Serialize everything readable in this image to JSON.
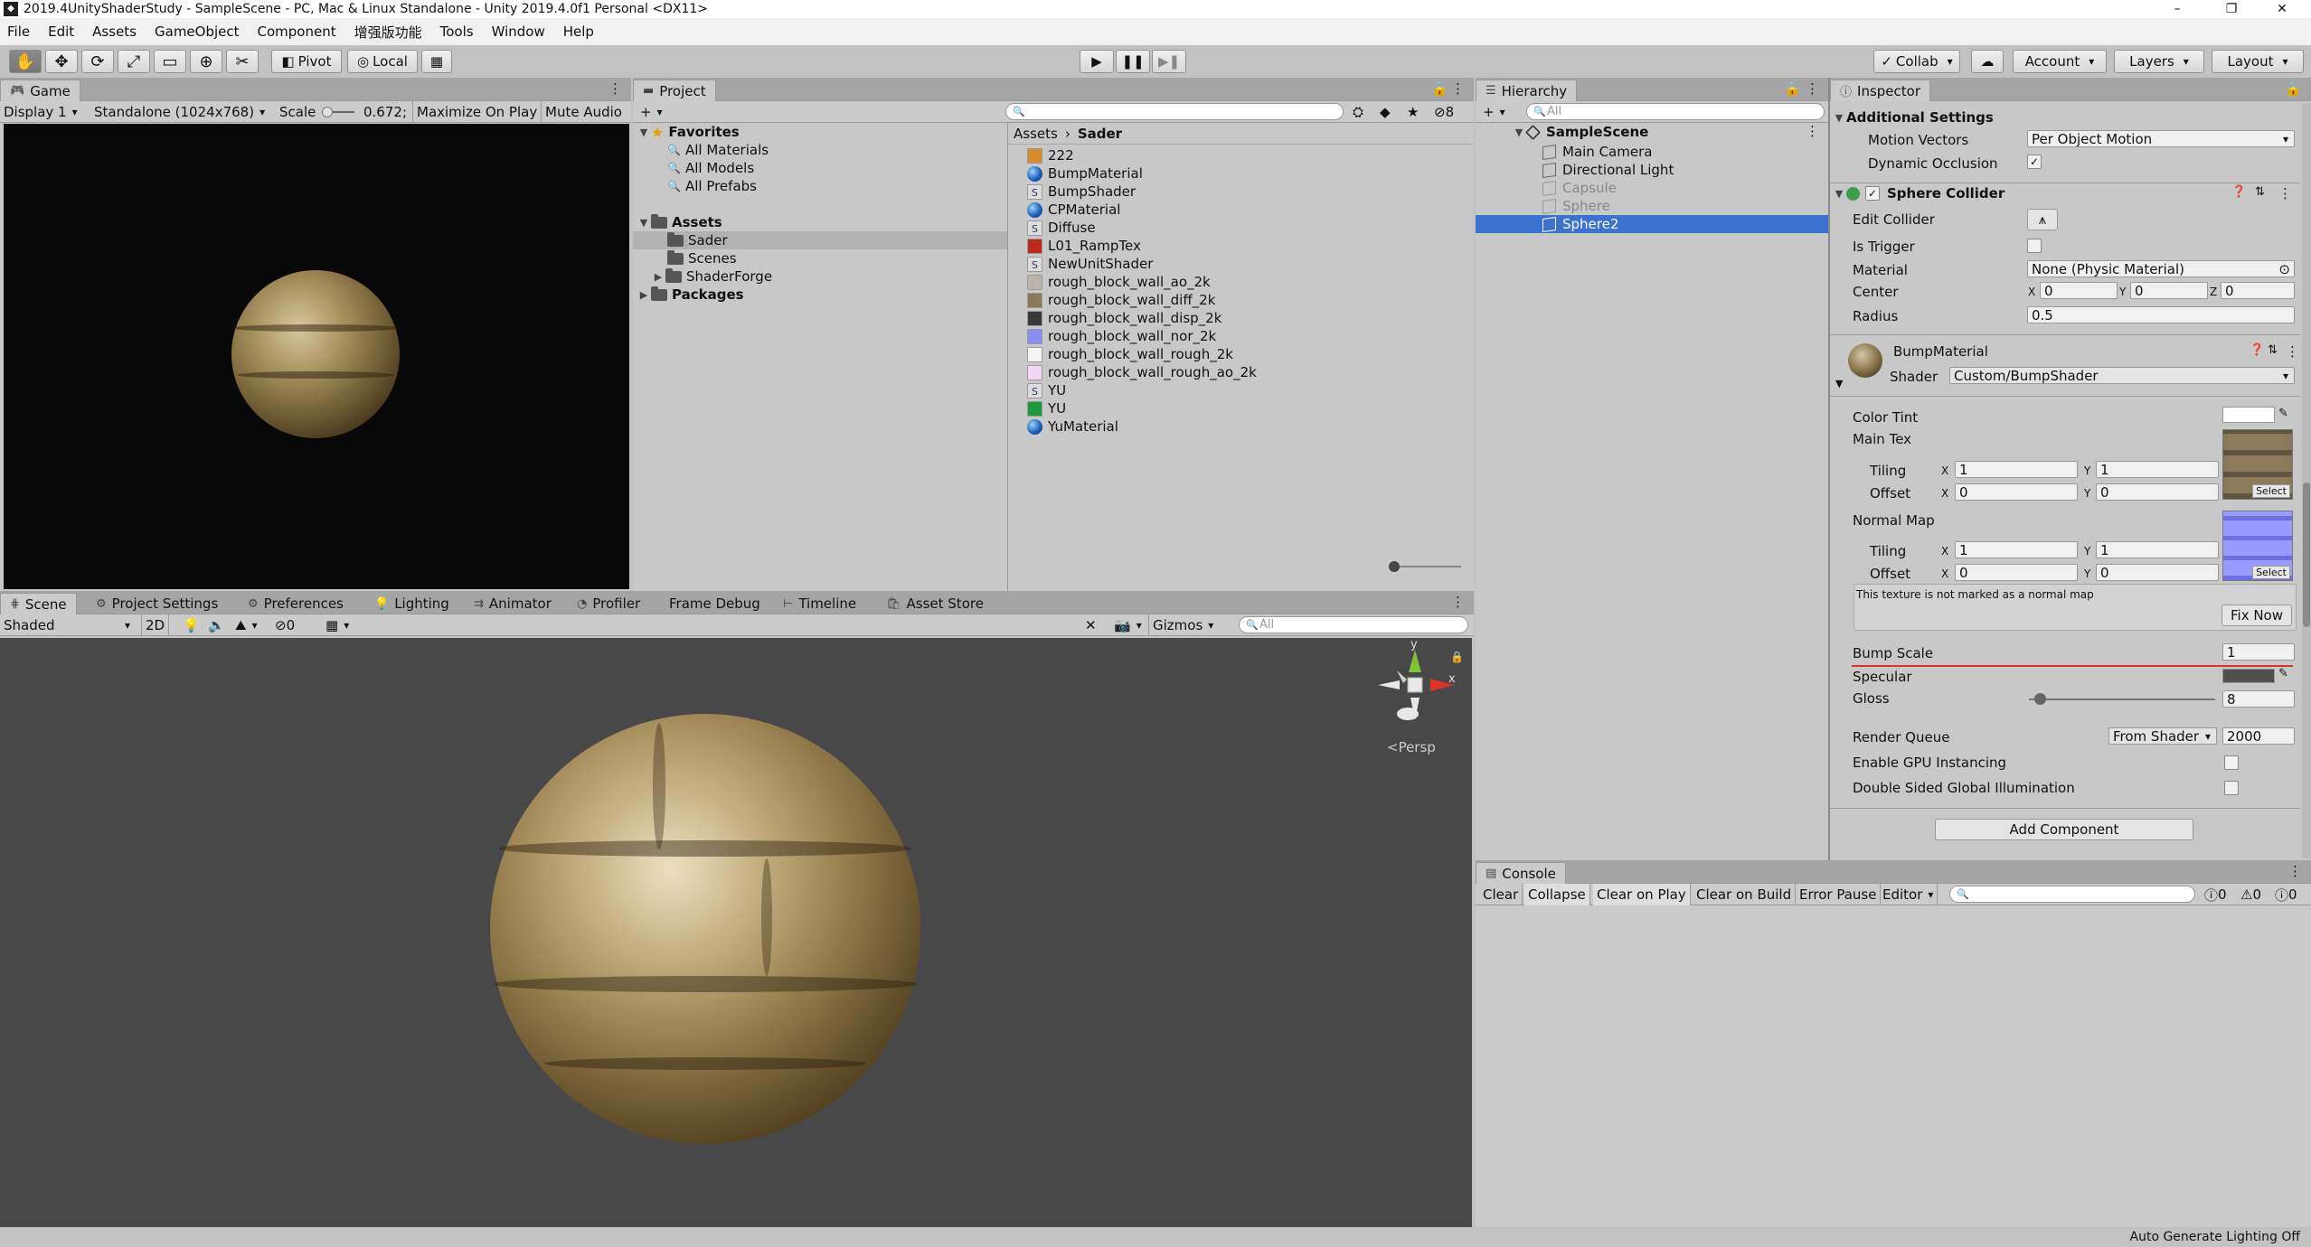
{
  "window": {
    "title": "2019.4UnityShaderStudy - SampleScene - PC, Mac & Linux Standalone - Unity 2019.4.0f1 Personal <DX11>",
    "app_icon_label": "◆",
    "minimize": "–",
    "maximize": "❐",
    "close": "✕"
  },
  "menu": [
    "File",
    "Edit",
    "Assets",
    "GameObject",
    "Component",
    "增强版功能",
    "Tools",
    "Window",
    "Help"
  ],
  "toolbar": {
    "tools": [
      "✋",
      "✥",
      "⟳",
      "⤢",
      "▭",
      "⊕",
      "✂"
    ],
    "pivot": "Pivot",
    "local": "Local",
    "collab": "Collab",
    "account": "Account",
    "layers": "Layers",
    "layout": "Layout",
    "play_icons": [
      "▶",
      "❚❚",
      "▶❚"
    ]
  },
  "game": {
    "tab": "Game",
    "display": "Display 1",
    "resolution": "Standalone (1024x768)",
    "scale_label": "Scale",
    "scale_value": "0.672;",
    "maximize": "Maximize On Play",
    "mute": "Mute Audio"
  },
  "project": {
    "tab": "Project",
    "add": "+",
    "hidden_count": "8",
    "favorites": "Favorites",
    "favorites_items": [
      "All Materials",
      "All Models",
      "All Prefabs"
    ],
    "assets": "Assets",
    "asset_folders": [
      "Sader",
      "Scenes",
      "ShaderForge"
    ],
    "packages": "Packages",
    "breadcrumb_root": "Assets",
    "breadcrumb_current": "Sader",
    "files": [
      {
        "name": "222",
        "kind": "tex",
        "color": "#d98a2a"
      },
      {
        "name": "BumpMaterial",
        "kind": "mat"
      },
      {
        "name": "BumpShader",
        "kind": "shader"
      },
      {
        "name": "CPMaterial",
        "kind": "mat"
      },
      {
        "name": "Diffuse",
        "kind": "shader"
      },
      {
        "name": "L01_RampTex",
        "kind": "tex",
        "color": "#c0271d"
      },
      {
        "name": "NewUnitShader",
        "kind": "shader"
      },
      {
        "name": "rough_block_wall_ao_2k",
        "kind": "tex",
        "color": "#b8b3ab"
      },
      {
        "name": "rough_block_wall_diff_2k",
        "kind": "tex",
        "color": "#8b7a5a"
      },
      {
        "name": "rough_block_wall_disp_2k",
        "kind": "tex",
        "color": "#3a3a3a"
      },
      {
        "name": "rough_block_wall_nor_2k",
        "kind": "tex",
        "color": "#8a8cf5"
      },
      {
        "name": "rough_block_wall_rough_2k",
        "kind": "tex",
        "color": "#f4f4f4"
      },
      {
        "name": "rough_block_wall_rough_ao_2k",
        "kind": "tex",
        "color": "#f3d7f3"
      },
      {
        "name": "YU",
        "kind": "shader"
      },
      {
        "name": "YU",
        "kind": "tex",
        "color": "#1a9a3a"
      },
      {
        "name": "YuMaterial",
        "kind": "mat"
      }
    ]
  },
  "scene": {
    "tabs": [
      "Scene",
      "Project Settings",
      "Preferences",
      "Lighting",
      "Animator",
      "Profiler",
      "Frame Debug",
      "Timeline",
      "Asset Store"
    ],
    "shading": "Shaded",
    "mode_2d": "2D",
    "hidden": "0",
    "gizmos": "Gizmos",
    "search_placeholder": "All",
    "persp": "<Persp",
    "axis_y": "y",
    "axis_x": "x"
  },
  "hierarchy": {
    "tab": "Hierarchy",
    "search_placeholder": "All",
    "scene": "SampleScene",
    "objects": [
      {
        "name": "Main Camera",
        "dim": false
      },
      {
        "name": "Directional Light",
        "dim": false
      },
      {
        "name": "Capsule",
        "dim": true
      },
      {
        "name": "Sphere",
        "dim": true
      },
      {
        "name": "Sphere2",
        "selected": true
      }
    ]
  },
  "inspector": {
    "tab": "Inspector",
    "additional_settings": "Additional Settings",
    "motion_vectors_label": "Motion Vectors",
    "motion_vectors_value": "Per Object Motion",
    "dynamic_occlusion_label": "Dynamic Occlusion",
    "sphere_collider": "Sphere Collider",
    "edit_collider": "Edit Collider",
    "is_trigger": "Is Trigger",
    "material_label": "Material",
    "material_value": "None (Physic Material)",
    "center_label": "Center",
    "center": {
      "x": "0",
      "y": "0",
      "z": "0"
    },
    "radius_label": "Radius",
    "radius_value": "0.5",
    "material_name": "BumpMaterial",
    "shader_label": "Shader",
    "shader_value": "Custom/BumpShader",
    "color_tint": "Color Tint",
    "main_tex": "Main Tex",
    "tiling": "Tiling",
    "offset": "Offset",
    "main_tiling": {
      "x": "1",
      "y": "1"
    },
    "main_offset": {
      "x": "0",
      "y": "0"
    },
    "normal_map": "Normal Map",
    "normal_tiling": {
      "x": "1",
      "y": "1"
    },
    "normal_offset": {
      "x": "0",
      "y": "0"
    },
    "select": "Select",
    "normal_warning": "This texture is not marked as a normal map",
    "fix_now": "Fix Now",
    "bump_scale_label": "Bump Scale",
    "bump_scale_value": "1",
    "specular_label": "Specular",
    "gloss_label": "Gloss",
    "gloss_value": "8",
    "gloss_level": 0.03,
    "render_queue_label": "Render Queue",
    "render_queue_mode": "From Shader",
    "render_queue_value": "2000",
    "gpu_instancing": "Enable GPU Instancing",
    "double_sided_gi": "Double Sided Global Illumination",
    "add_component": "Add Component",
    "axis_x": "X",
    "axis_y": "Y",
    "axis_z": "Z"
  },
  "console": {
    "tab": "Console",
    "buttons": [
      "Clear",
      "Collapse",
      "Clear on Play",
      "Clear on Build",
      "Error Pause",
      "Editor"
    ],
    "info_count": "0",
    "warn_count": "0",
    "error_count": "0"
  },
  "status": {
    "right": "Auto Generate Lighting Off"
  },
  "colors": {
    "selection": "#3a72d0",
    "accent_red": "#e0302a"
  }
}
